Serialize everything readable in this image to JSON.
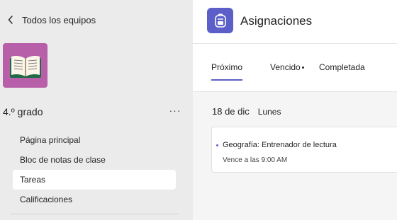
{
  "sidebar": {
    "back_label": "Todos los equipos",
    "team_name": "4.º grado",
    "more_label": "···",
    "items": [
      {
        "label": "Página principal"
      },
      {
        "label": "Bloc de notas de clase"
      },
      {
        "label": "Tareas",
        "active": true
      },
      {
        "label": "Calificaciones"
      }
    ],
    "logo_color": "#b75fa8"
  },
  "header": {
    "title": "Asignaciones",
    "icon": "backpack-icon",
    "accent": "#5b5fc7"
  },
  "tabs": [
    {
      "label": "Próximo",
      "active": true
    },
    {
      "label": "Vencido",
      "has_dot": true
    },
    {
      "label": "Completada"
    }
  ],
  "date_group": {
    "date": "18 de dic",
    "weekday": "Lunes"
  },
  "assignment": {
    "title": "Geografía: Entrenador de lectura",
    "due": "Vence a las 9:00 AM"
  }
}
